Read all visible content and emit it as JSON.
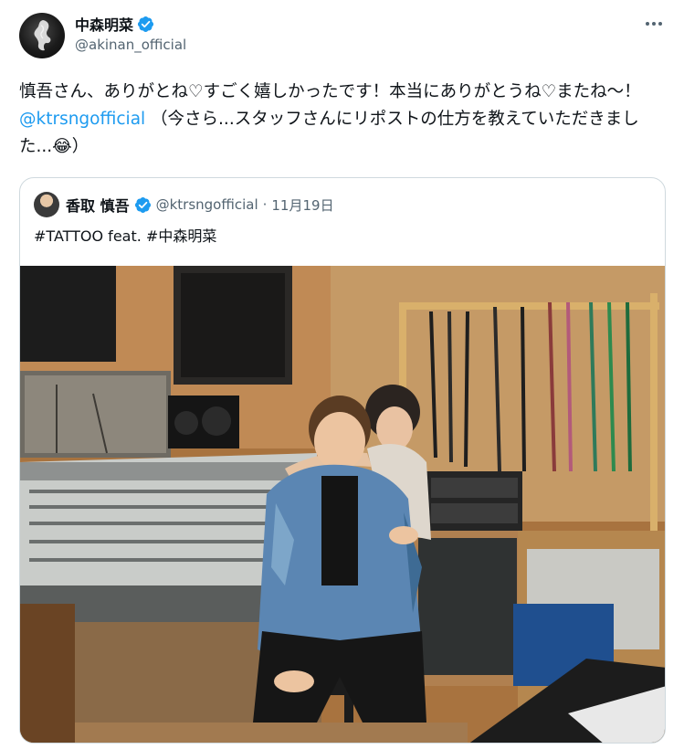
{
  "post": {
    "author_name": "中森明菜",
    "author_handle": "@akinan_official",
    "verified_icon": "verified-badge-icon",
    "more_icon": "more-horizontal-icon",
    "text_part1": "慎吾さん、ありがとね♡すごく嬉しかったです！本当にありがとうね♡またね〜！ ",
    "mention": "@ktrsngofficial",
    "text_part2": " （今さら...スタッフさんにリポストの仕方を教えていただきました...",
    "emoji": "😂",
    "text_part3": "）"
  },
  "quoted_post": {
    "author_name": "香取 慎吾",
    "author_handle": "@ktrsngofficial",
    "separator": "·",
    "date": "11月19日",
    "text": "#TATTOO feat. #中森明菜",
    "photo_icon": "recording-studio-photo"
  },
  "colors": {
    "text": "#0f1419",
    "secondary": "#536471",
    "link": "#1d9bf0",
    "border": "#cfd9de"
  }
}
